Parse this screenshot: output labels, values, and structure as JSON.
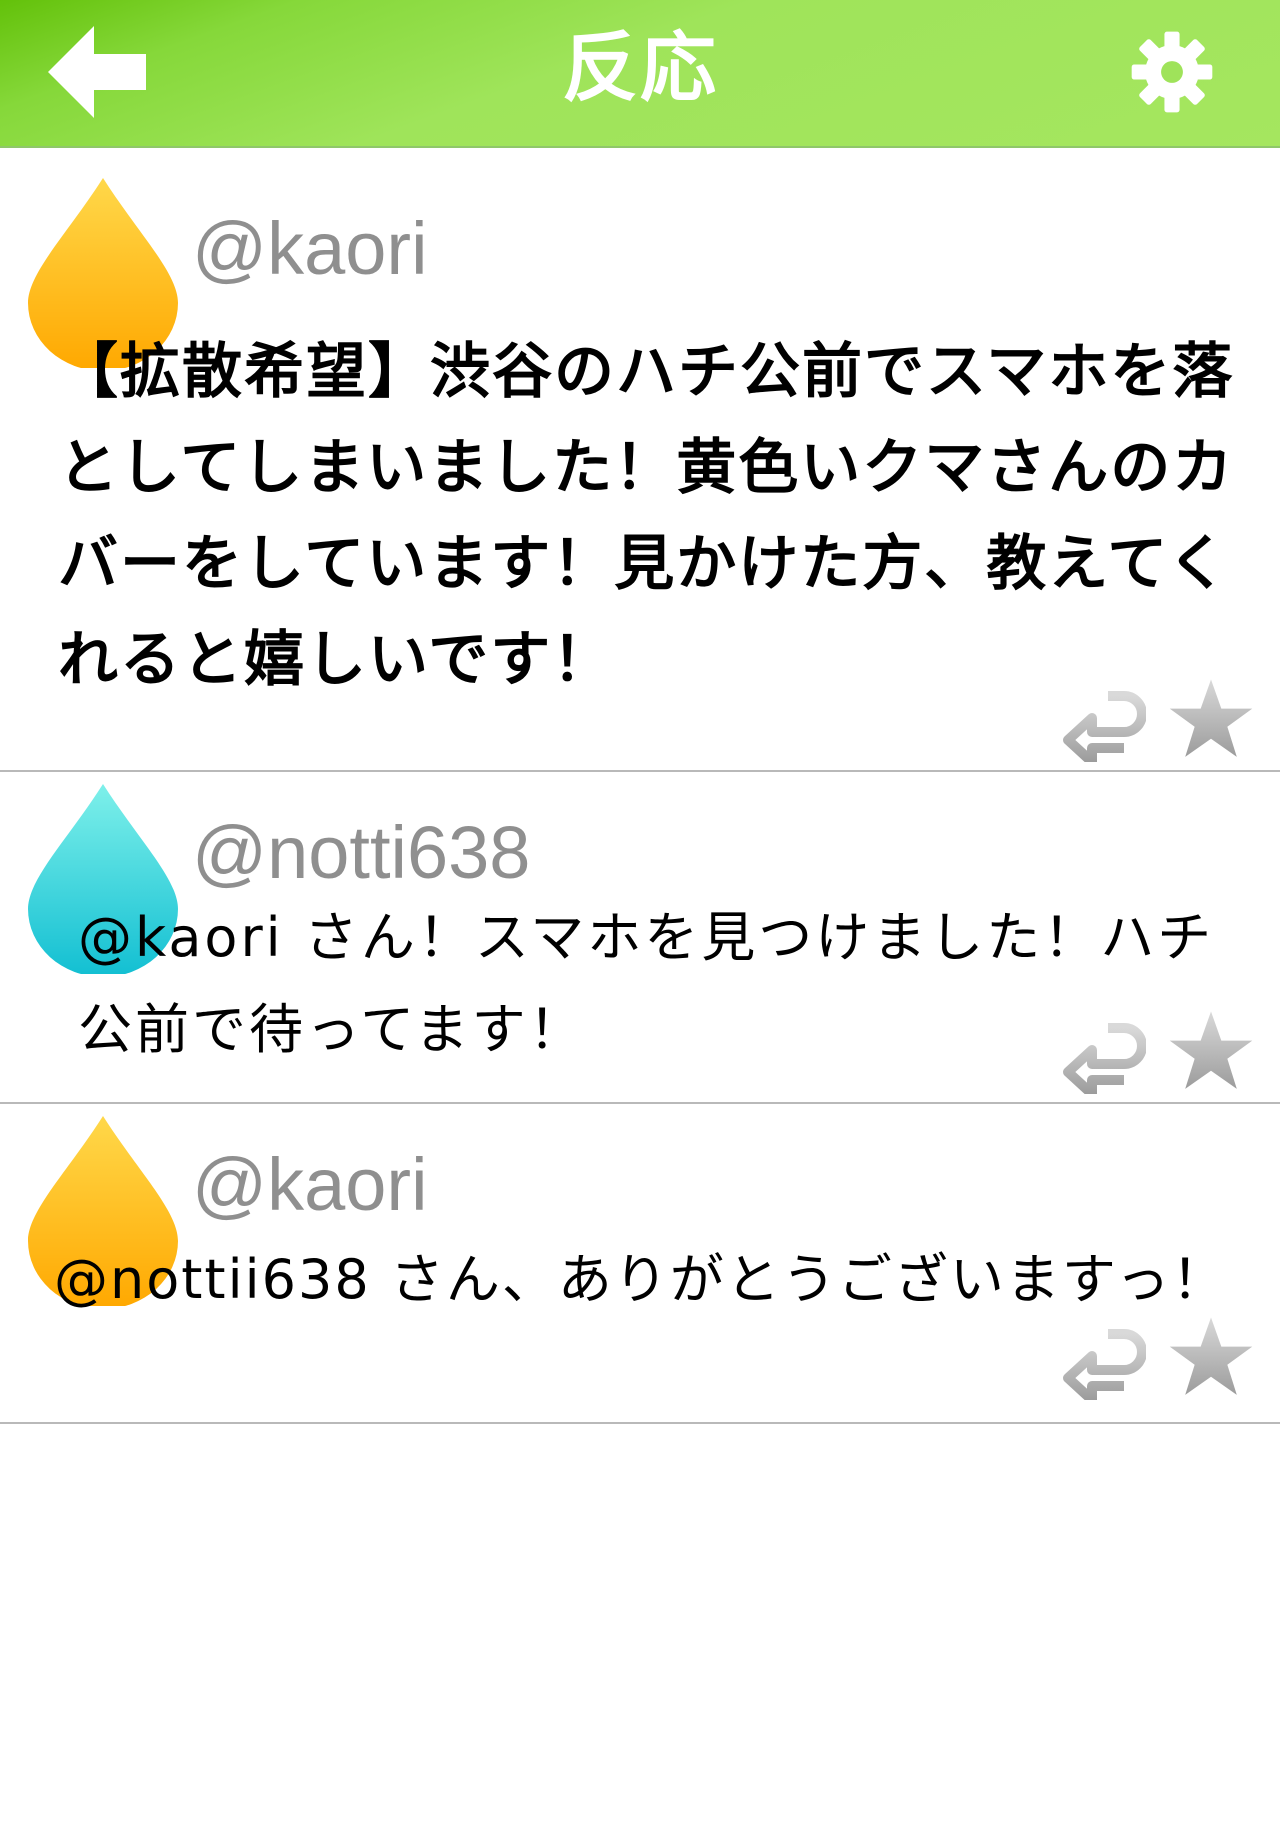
{
  "header": {
    "title": "反応",
    "back_icon": "back-arrow-icon",
    "settings_icon": "gear-icon",
    "colors": {
      "bar_start": "#63c10a",
      "bar_end": "#a5e65f",
      "title": "#ffffff"
    }
  },
  "posts": [
    {
      "username": "@kaori",
      "avatar_color": "#ffb000",
      "avatar_icon": "drop-avatar-icon",
      "text": "【拡散希望】渋谷のハチ公前でスマホを落としてしまいました！黄色いクマさんのカバーをしています！見かけた方、教えてくれると嬉しいです！",
      "reply_icon": "reply-icon",
      "favorite_icon": "star-icon"
    },
    {
      "username": "@notti638",
      "avatar_color": "#1ec8d6",
      "avatar_icon": "drop-avatar-icon",
      "text": "@kaori さん！スマホを見つけました！ハチ公前で待ってます！",
      "reply_icon": "reply-icon",
      "favorite_icon": "star-icon"
    },
    {
      "username": "@kaori",
      "avatar_color": "#ffb000",
      "avatar_icon": "drop-avatar-icon",
      "text": "@nottii638 さん、ありがとうございますっ！",
      "reply_icon": "reply-icon",
      "favorite_icon": "star-icon"
    }
  ]
}
